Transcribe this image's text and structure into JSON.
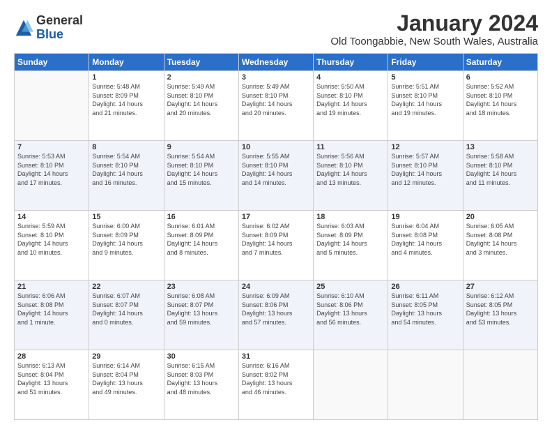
{
  "logo": {
    "general": "General",
    "blue": "Blue"
  },
  "header": {
    "month": "January 2024",
    "location": "Old Toongabbie, New South Wales, Australia"
  },
  "columns": [
    "Sunday",
    "Monday",
    "Tuesday",
    "Wednesday",
    "Thursday",
    "Friday",
    "Saturday"
  ],
  "weeks": [
    [
      {
        "day": "",
        "info": ""
      },
      {
        "day": "1",
        "info": "Sunrise: 5:48 AM\nSunset: 8:09 PM\nDaylight: 14 hours\nand 21 minutes."
      },
      {
        "day": "2",
        "info": "Sunrise: 5:49 AM\nSunset: 8:10 PM\nDaylight: 14 hours\nand 20 minutes."
      },
      {
        "day": "3",
        "info": "Sunrise: 5:49 AM\nSunset: 8:10 PM\nDaylight: 14 hours\nand 20 minutes."
      },
      {
        "day": "4",
        "info": "Sunrise: 5:50 AM\nSunset: 8:10 PM\nDaylight: 14 hours\nand 19 minutes."
      },
      {
        "day": "5",
        "info": "Sunrise: 5:51 AM\nSunset: 8:10 PM\nDaylight: 14 hours\nand 19 minutes."
      },
      {
        "day": "6",
        "info": "Sunrise: 5:52 AM\nSunset: 8:10 PM\nDaylight: 14 hours\nand 18 minutes."
      }
    ],
    [
      {
        "day": "7",
        "info": "Sunrise: 5:53 AM\nSunset: 8:10 PM\nDaylight: 14 hours\nand 17 minutes."
      },
      {
        "day": "8",
        "info": "Sunrise: 5:54 AM\nSunset: 8:10 PM\nDaylight: 14 hours\nand 16 minutes."
      },
      {
        "day": "9",
        "info": "Sunrise: 5:54 AM\nSunset: 8:10 PM\nDaylight: 14 hours\nand 15 minutes."
      },
      {
        "day": "10",
        "info": "Sunrise: 5:55 AM\nSunset: 8:10 PM\nDaylight: 14 hours\nand 14 minutes."
      },
      {
        "day": "11",
        "info": "Sunrise: 5:56 AM\nSunset: 8:10 PM\nDaylight: 14 hours\nand 13 minutes."
      },
      {
        "day": "12",
        "info": "Sunrise: 5:57 AM\nSunset: 8:10 PM\nDaylight: 14 hours\nand 12 minutes."
      },
      {
        "day": "13",
        "info": "Sunrise: 5:58 AM\nSunset: 8:10 PM\nDaylight: 14 hours\nand 11 minutes."
      }
    ],
    [
      {
        "day": "14",
        "info": "Sunrise: 5:59 AM\nSunset: 8:10 PM\nDaylight: 14 hours\nand 10 minutes."
      },
      {
        "day": "15",
        "info": "Sunrise: 6:00 AM\nSunset: 8:09 PM\nDaylight: 14 hours\nand 9 minutes."
      },
      {
        "day": "16",
        "info": "Sunrise: 6:01 AM\nSunset: 8:09 PM\nDaylight: 14 hours\nand 8 minutes."
      },
      {
        "day": "17",
        "info": "Sunrise: 6:02 AM\nSunset: 8:09 PM\nDaylight: 14 hours\nand 7 minutes."
      },
      {
        "day": "18",
        "info": "Sunrise: 6:03 AM\nSunset: 8:09 PM\nDaylight: 14 hours\nand 5 minutes."
      },
      {
        "day": "19",
        "info": "Sunrise: 6:04 AM\nSunset: 8:08 PM\nDaylight: 14 hours\nand 4 minutes."
      },
      {
        "day": "20",
        "info": "Sunrise: 6:05 AM\nSunset: 8:08 PM\nDaylight: 14 hours\nand 3 minutes."
      }
    ],
    [
      {
        "day": "21",
        "info": "Sunrise: 6:06 AM\nSunset: 8:08 PM\nDaylight: 14 hours\nand 1 minute."
      },
      {
        "day": "22",
        "info": "Sunrise: 6:07 AM\nSunset: 8:07 PM\nDaylight: 14 hours\nand 0 minutes."
      },
      {
        "day": "23",
        "info": "Sunrise: 6:08 AM\nSunset: 8:07 PM\nDaylight: 13 hours\nand 59 minutes."
      },
      {
        "day": "24",
        "info": "Sunrise: 6:09 AM\nSunset: 8:06 PM\nDaylight: 13 hours\nand 57 minutes."
      },
      {
        "day": "25",
        "info": "Sunrise: 6:10 AM\nSunset: 8:06 PM\nDaylight: 13 hours\nand 56 minutes."
      },
      {
        "day": "26",
        "info": "Sunrise: 6:11 AM\nSunset: 8:05 PM\nDaylight: 13 hours\nand 54 minutes."
      },
      {
        "day": "27",
        "info": "Sunrise: 6:12 AM\nSunset: 8:05 PM\nDaylight: 13 hours\nand 53 minutes."
      }
    ],
    [
      {
        "day": "28",
        "info": "Sunrise: 6:13 AM\nSunset: 8:04 PM\nDaylight: 13 hours\nand 51 minutes."
      },
      {
        "day": "29",
        "info": "Sunrise: 6:14 AM\nSunset: 8:04 PM\nDaylight: 13 hours\nand 49 minutes."
      },
      {
        "day": "30",
        "info": "Sunrise: 6:15 AM\nSunset: 8:03 PM\nDaylight: 13 hours\nand 48 minutes."
      },
      {
        "day": "31",
        "info": "Sunrise: 6:16 AM\nSunset: 8:02 PM\nDaylight: 13 hours\nand 46 minutes."
      },
      {
        "day": "",
        "info": ""
      },
      {
        "day": "",
        "info": ""
      },
      {
        "day": "",
        "info": ""
      }
    ]
  ]
}
